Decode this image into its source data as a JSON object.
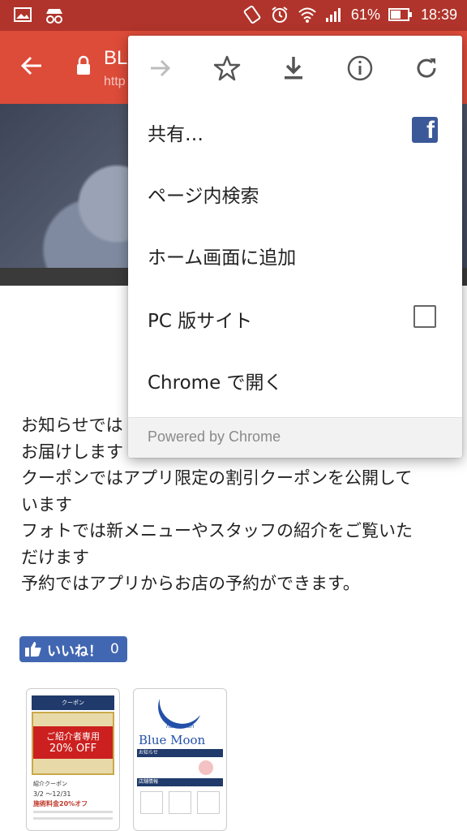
{
  "status_bar": {
    "battery": "61%",
    "time": "18:39",
    "icons": [
      "image-icon",
      "incognito-icon",
      "rotate-icon",
      "alarm-icon",
      "wifi-icon",
      "signal-icon",
      "battery-icon"
    ]
  },
  "toolbar": {
    "title": "BL",
    "url": "http"
  },
  "menu": {
    "top_icons": [
      "forward-icon",
      "bookmark-star-icon",
      "download-icon",
      "info-icon",
      "reload-icon"
    ],
    "items": [
      {
        "label": "共有…"
      },
      {
        "label": "ページ内検索"
      },
      {
        "label": "ホーム画面に追加"
      },
      {
        "label": "PC 版サイト"
      },
      {
        "label": "Chrome で開く"
      }
    ],
    "footer": "Powered by Chrome"
  },
  "content": {
    "lines": [
      "お知らせでは",
      "お届けします",
      "クーポンではアプリ限定の割引クーポンを公開して",
      "います",
      "フォトでは新メニューやスタッフの紹介をご覧いた",
      "だけます",
      "予約ではアプリからお店の予約ができます。"
    ]
  },
  "like_button": {
    "label": "いいね！",
    "count": "0"
  },
  "thumbs": {
    "one": {
      "header": "クーポン",
      "banner_line1": "ご紹介者専用",
      "banner_line2": "20% OFF",
      "caption": "紹介クーポン",
      "dates": "3/2 ～12/31",
      "discount": "施術料金20%オフ"
    },
    "two": {
      "logo_small": "hair salon",
      "logo": "Blue Moon",
      "section1": "お知らせ",
      "section2": "店舗情報"
    }
  },
  "colors": {
    "status_bar": "#b0342b",
    "toolbar": "#dd4b39",
    "facebook": "#3b5998",
    "like_button": "#4267b2"
  }
}
